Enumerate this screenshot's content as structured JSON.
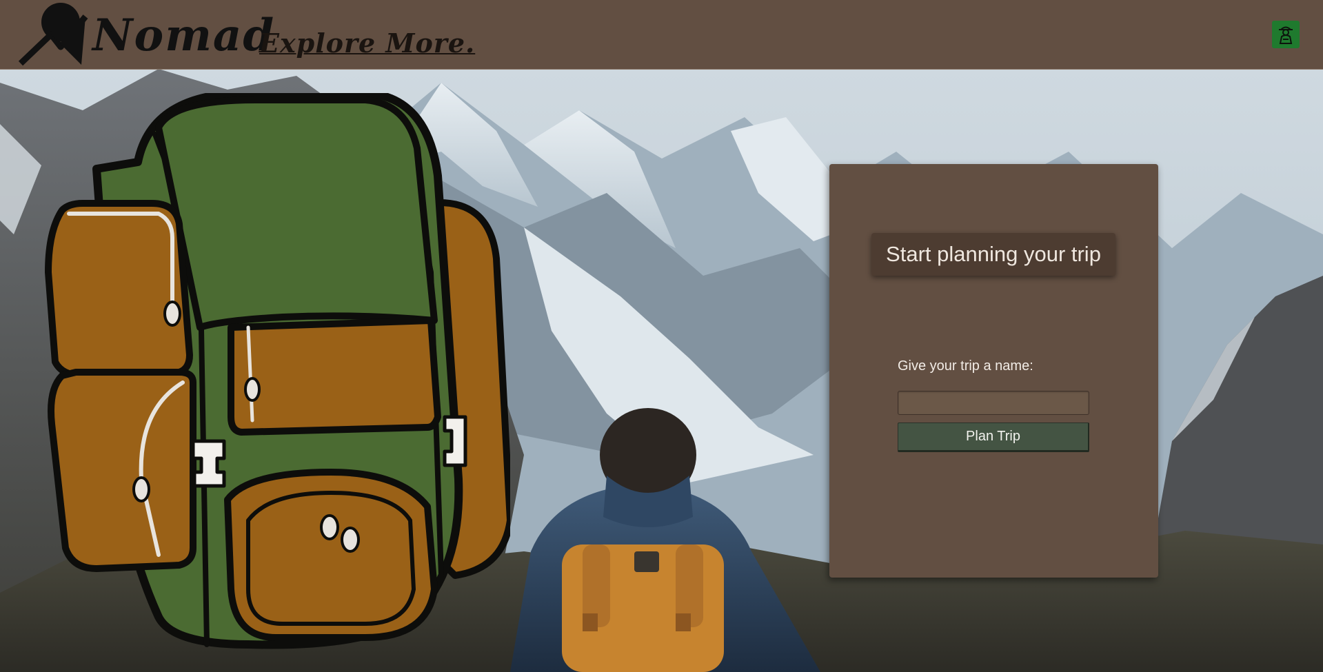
{
  "brand": {
    "logo_text": "Nomad",
    "tagline": "Explore More."
  },
  "header": {
    "profile_icon": "hiker-icon"
  },
  "planner": {
    "title": "Start planning your trip",
    "name_label": "Give your trip a name:",
    "name_value": "",
    "name_placeholder": "",
    "submit_label": "Plan Trip"
  },
  "colors": {
    "header_bg": "#624f42",
    "card_bg": "#624f42",
    "title_bg": "#4d3c31",
    "button_bg": "#445443",
    "profile_bg": "#1f7a2e",
    "backpack_green": "#4b6b32",
    "backpack_orange": "#9a6117"
  }
}
